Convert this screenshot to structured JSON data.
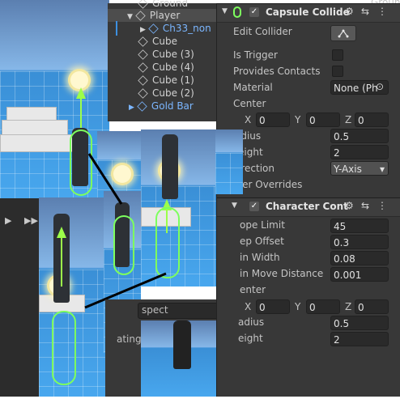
{
  "hierarchy": {
    "items": [
      {
        "label": "Ground",
        "blue": false
      },
      {
        "label": "Player",
        "blue": false
      },
      {
        "label": "Ch33_non",
        "blue": true
      },
      {
        "label": "Cube",
        "blue": false
      },
      {
        "label": "Cube (3)",
        "blue": false
      },
      {
        "label": "Cube (4)",
        "blue": false
      },
      {
        "label": "Cube (1)",
        "blue": false
      },
      {
        "label": "Cube (2)",
        "blue": false
      },
      {
        "label": "Gold Bar",
        "blue": true
      }
    ],
    "far_right_label": "Groun"
  },
  "capsule_collider": {
    "title": "Capsule Collide",
    "edit_collider_label": "Edit Collider",
    "is_trigger_label": "Is Trigger",
    "provides_contacts_label": "Provides Contacts",
    "material_label": "Material",
    "material_value": "None (Ph",
    "center_label": "Center",
    "center": {
      "x_label": "X",
      "x": "0",
      "y_label": "Y",
      "y": "0",
      "z_label": "Z",
      "z": "0"
    },
    "radius_label": "adius",
    "radius_value": "0.5",
    "height_label": "eight",
    "height_value": "2",
    "direction_label": "irection",
    "direction_value": "Y-Axis",
    "layer_overrides_label": "yer Overrides"
  },
  "character_controller": {
    "title": "Character Cont",
    "slope_limit_label": "ope Limit",
    "slope_limit_value": "45",
    "step_offset_label": "ep Offset",
    "step_offset_value": "0.3",
    "skin_width_label": "in Width",
    "skin_width_value": "0.08",
    "min_move_label": "in Move Distance",
    "min_move_value": "0.001",
    "center_label": "enter",
    "center": {
      "x_label": "X",
      "x": "0",
      "y_label": "Y",
      "y": "0",
      "z_label": "Z",
      "z": "0"
    },
    "radius_label": "adius",
    "radius_value": "0.5",
    "height_label": "eight",
    "height_value": "2"
  },
  "lower_panel": {
    "inspect_label": "spect",
    "s_label": "S",
    "rating_label": "ating"
  },
  "icons": {
    "settings": "⚙",
    "sliders": "⇆",
    "menu": "⋮",
    "check": "✓",
    "play": "▶"
  },
  "colors": {
    "panel": "#383838",
    "field": "#2a2a2a",
    "blue_text": "#7bb6ff",
    "gizmo_green": "#7dff5e"
  }
}
